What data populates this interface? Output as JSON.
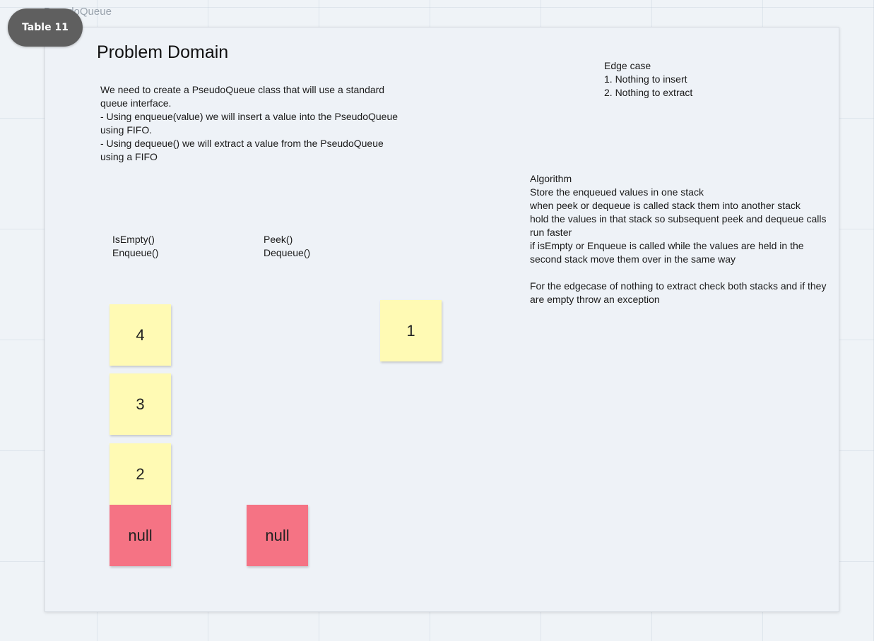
{
  "frame": {
    "label": "PseudoQueue",
    "badge": "Table 11"
  },
  "title": "Problem Domain",
  "description": "We need to create a PseudoQueue class that will use a standard\nqueue interface.\n- Using enqueue(value) we will insert a value into the PseudoQueue\nusing FIFO.\n- Using dequeue() we will extract a value from the PseudoQueue\nusing a FIFO",
  "edge_case": "Edge case\n1. Nothing to insert\n2. Nothing to extract",
  "algorithm": "Algorithm\nStore the enqueued values in one stack\nwhen peek or dequeue is called stack them into another stack\nhold the values in that stack so subsequent peek and dequeue calls\nrun faster\nif isEmpty or Enqueue is called while the values are held in the\nsecond stack move them over in the same way\n\nFor the edgecase of nothing to extract check both stacks and if they\nare empty throw an exception",
  "methods_left": "IsEmpty()\nEnqueue()",
  "methods_right": "Peek()\nDequeue()",
  "stickies": {
    "stack1": [
      "4",
      "3",
      "2",
      "null"
    ],
    "stack2": [
      "null"
    ],
    "loose": "1"
  },
  "colors": {
    "sticky_yellow": "#fffab4",
    "sticky_red": "#f57384",
    "badge": "#5f5f5f"
  }
}
